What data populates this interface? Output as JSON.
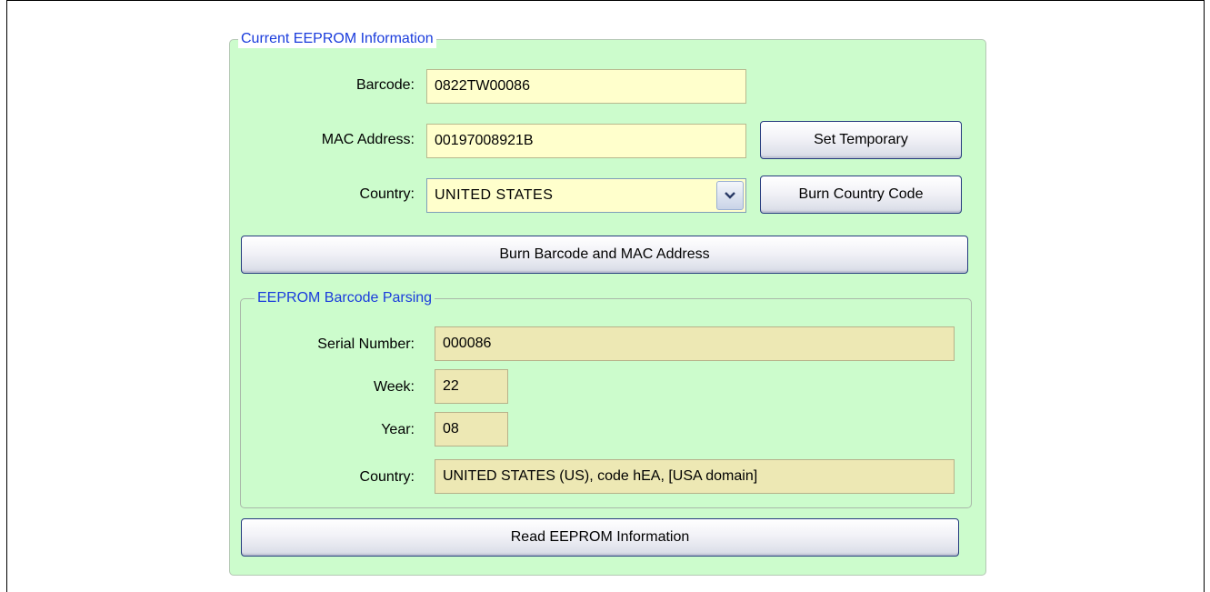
{
  "group_title": "Current EEPROM Information",
  "barcode": {
    "label": "Barcode:",
    "value": "0822TW00086"
  },
  "mac": {
    "label": "MAC Address:",
    "value": "00197008921B"
  },
  "country": {
    "label": "Country:",
    "value": "UNITED STATES"
  },
  "buttons": {
    "set_temporary": "Set Temporary",
    "burn_country": "Burn Country Code",
    "burn_barcode_mac": "Burn Barcode and MAC Address",
    "read_eeprom": "Read EEPROM Information"
  },
  "parsing": {
    "title": "EEPROM Barcode Parsing",
    "serial": {
      "label": "Serial Number:",
      "value": "000086"
    },
    "week": {
      "label": "Week:",
      "value": "22"
    },
    "year": {
      "label": "Year:",
      "value": "08"
    },
    "country": {
      "label": "Country:",
      "value": "UNITED STATES (US), code hEA, [USA domain]"
    }
  },
  "icons": {
    "dropdown": "chevron-down-icon"
  }
}
